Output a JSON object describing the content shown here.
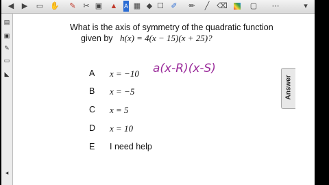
{
  "question": {
    "line1": "What is the axis of symmetry of the quadratic function",
    "line2_prefix": "given by",
    "function_expr": "h(x) = 4(x − 15)(x + 25)?"
  },
  "handwriting": {
    "text": "a(x-R)(x-S)",
    "color": "#9a2a9a"
  },
  "choices": [
    {
      "letter": "A",
      "text": "x = −10"
    },
    {
      "letter": "B",
      "text": "x = −5"
    },
    {
      "letter": "C",
      "text": "x = 5"
    },
    {
      "letter": "D",
      "text": "x = 10"
    },
    {
      "letter": "E",
      "text": "I need help"
    }
  ],
  "answer_tab": {
    "label": "Answer"
  },
  "toolbar_icons": [
    "back-icon",
    "forward-icon",
    "page-icon",
    "hand-icon",
    "pen-icon",
    "cut-icon",
    "image-icon",
    "select-icon",
    "text-icon",
    "table-icon",
    "shape-icon",
    "fill-icon",
    "brush-icon",
    "pen-tool-icon",
    "line-icon",
    "eraser-icon",
    "color-icon",
    "screen-icon",
    "more-icon",
    "menu-icon"
  ],
  "sidebar_icons": [
    "page-sorter-icon",
    "gallery-icon",
    "attachments-icon",
    "properties-icon",
    "add-ons-icon"
  ]
}
